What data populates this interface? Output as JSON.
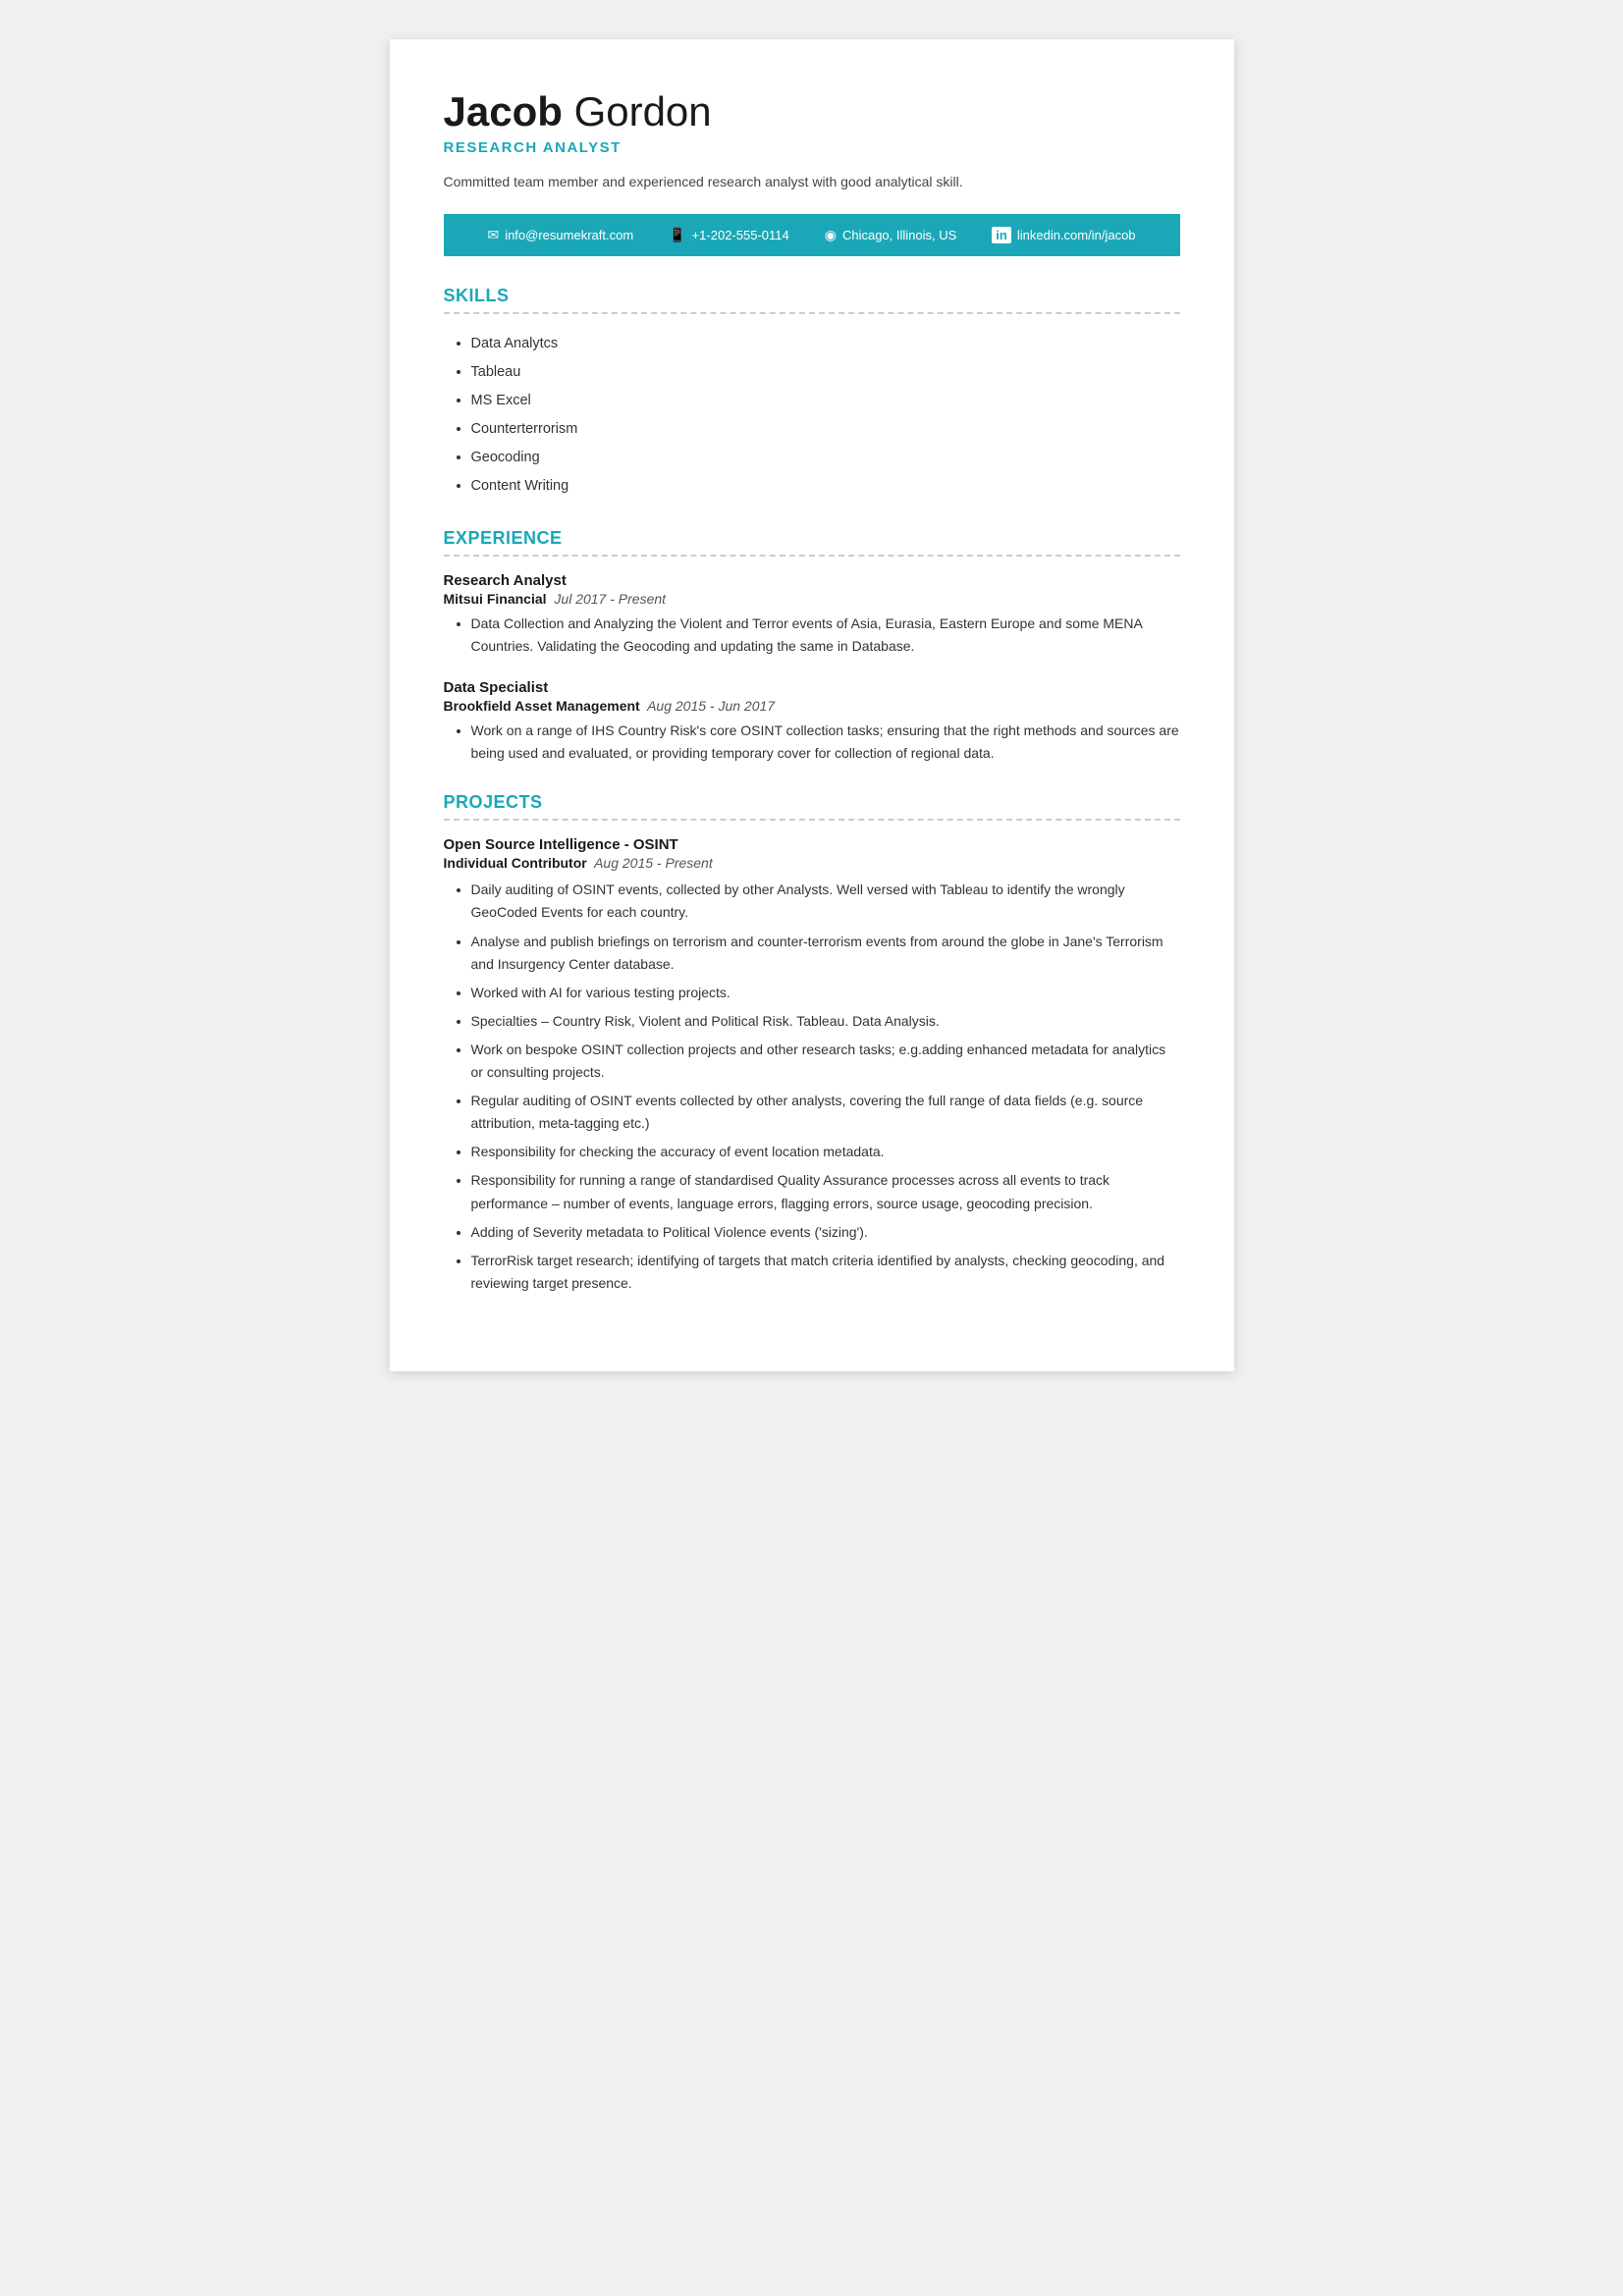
{
  "header": {
    "first_name": "Jacob",
    "last_name": "Gordon",
    "title": "RESEARCH ANALYST",
    "summary": "Committed team member and experienced research analyst with good analytical skill."
  },
  "contact": {
    "email": "info@resumekraft.com",
    "phone": "+1-202-555-0114",
    "location": "Chicago, Illinois, US",
    "linkedin": "linkedin.com/in/jacob",
    "email_icon": "✉",
    "phone_icon": "☐",
    "location_icon": "◉",
    "linkedin_icon": "in"
  },
  "skills": {
    "section_title": "SKILLS",
    "items": [
      "Data Analytcs",
      "Tableau",
      "MS Excel",
      "Counterterrorism",
      "Geocoding",
      "Content Writing"
    ]
  },
  "experience": {
    "section_title": "EXPERIENCE",
    "items": [
      {
        "role": "Research Analyst",
        "company": "Mitsui Financial",
        "period": "Jul 2017 - Present",
        "bullets": [
          "Data Collection and Analyzing the Violent and Terror events of Asia, Eurasia, Eastern Europe and some MENA Countries. Validating the Geocoding and updating the same in Database."
        ]
      },
      {
        "role": "Data Specialist",
        "company": "Brookfield Asset Management",
        "period": "Aug 2015 - Jun 2017",
        "bullets": [
          "Work on a range of IHS Country Risk's core OSINT collection tasks; ensuring that the right methods and sources are being used and evaluated, or providing temporary cover for collection of regional data."
        ]
      }
    ]
  },
  "projects": {
    "section_title": "PROJECTS",
    "items": [
      {
        "name": "Open Source Intelligence - OSINT",
        "contributor": "Individual Contributor",
        "period": "Aug 2015 - Present",
        "bullets": [
          "Daily auditing of OSINT events, collected by other Analysts. Well versed with Tableau to identify the wrongly GeoCoded Events for each country.",
          "Analyse and publish briefings on terrorism and counter-terrorism events from around the globe in Jane's Terrorism and Insurgency Center database.",
          "Worked with AI for various testing projects.",
          "Specialties – Country Risk, Violent and Political Risk. Tableau. Data Analysis.",
          "Work on bespoke OSINT collection projects and other research tasks; e.g.adding enhanced metadata for analytics or consulting projects.",
          "Regular auditing of OSINT events collected by other analysts, covering the full range of data fields (e.g. source attribution, meta-tagging etc.)",
          "Responsibility for checking the accuracy of event location metadata.",
          "Responsibility for running a range of standardised Quality Assurance processes across all events to track performance – number of events, language errors, flagging errors, source usage, geocoding precision.",
          "Adding of Severity metadata to Political Violence events ('sizing').",
          "TerrorRisk target research; identifying of targets that match criteria identified by analysts, checking geocoding, and reviewing target presence."
        ]
      }
    ]
  }
}
